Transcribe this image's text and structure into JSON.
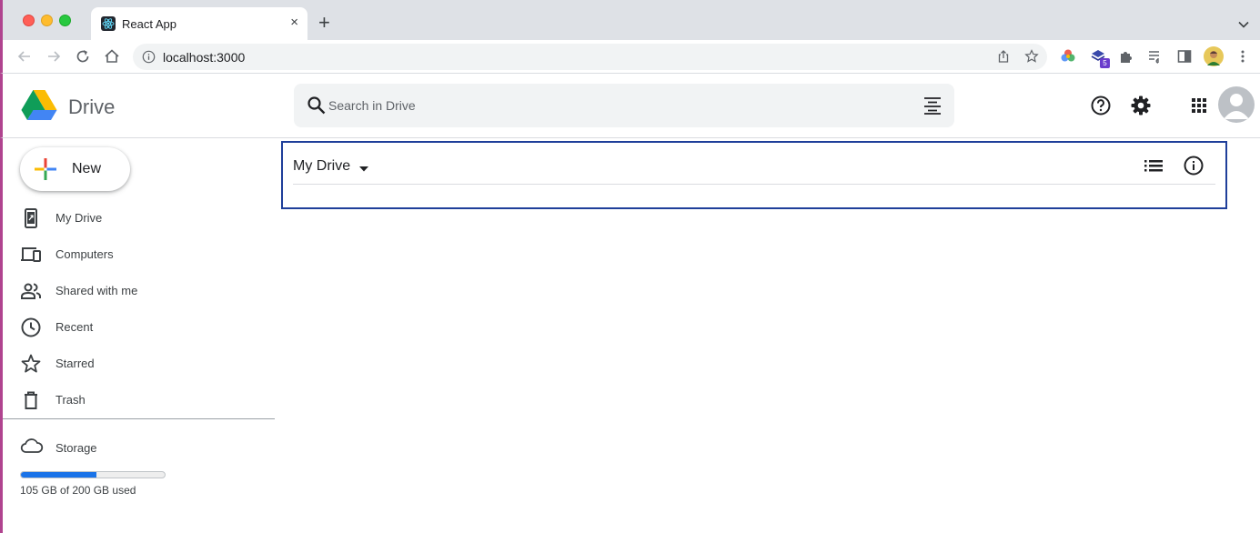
{
  "browser": {
    "tab_title": "React App",
    "tab_close": "×",
    "new_tab": "+",
    "url": "localhost:3000",
    "extension_badge": "5"
  },
  "header": {
    "brand": "Drive",
    "search_placeholder": "Search in Drive"
  },
  "sidebar": {
    "new_label": "New",
    "items": [
      {
        "label": "My Drive",
        "icon": "my-drive-icon"
      },
      {
        "label": "Computers",
        "icon": "computers-icon"
      },
      {
        "label": "Shared with me",
        "icon": "shared-icon"
      },
      {
        "label": "Recent",
        "icon": "clock-icon"
      },
      {
        "label": "Starred",
        "icon": "star-icon"
      },
      {
        "label": "Trash",
        "icon": "trash-icon"
      }
    ],
    "storage": {
      "label": "Storage",
      "used_text": "105 GB of 200 GB used",
      "used_fraction": 0.525
    }
  },
  "main": {
    "title": "My Drive"
  },
  "colors": {
    "accent": "#1a73e8",
    "focus_border": "#1f3f9a",
    "window_edge": "#b0448f"
  }
}
